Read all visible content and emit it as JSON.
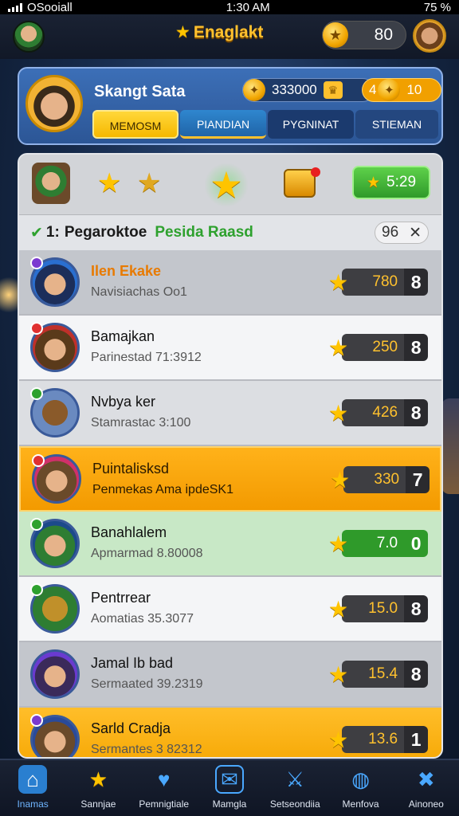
{
  "status": {
    "carrier": "OSooiall",
    "time": "1:30 AM",
    "battery": "75 %"
  },
  "topbar": {
    "title": "Enaglakt",
    "coins": "80",
    "coin_symbol": "★",
    "star": "★"
  },
  "profile": {
    "name": "Skangt Sata",
    "score": "333000",
    "level_prefix": "4",
    "level": "10",
    "tabs": [
      "MEMOSM",
      "PIANDIAN",
      "PYGNINAT",
      "STIEMAN"
    ]
  },
  "rewards": {
    "timer": "5:29",
    "star": "★"
  },
  "leaderboard": {
    "prefix": "1:",
    "title": "Pegaroktoe",
    "subtitle": "Pesida Raasd",
    "count": "96",
    "close": "✕",
    "rows": [
      {
        "name": "Ilen Ekake",
        "sub": "Navisiachas Oo1",
        "score": "780",
        "rank": "8"
      },
      {
        "name": "Bamajkan",
        "sub": "Parinestad 71:3912",
        "score": "250",
        "rank": "8"
      },
      {
        "name": "Nvbya ker",
        "sub": "Stamrastac 3:100",
        "score": "426",
        "rank": "8"
      },
      {
        "name": "Puintalisksd",
        "sub": "Penmekas Ama ipdeSK1",
        "score": "330",
        "rank": "7"
      },
      {
        "name": "Banahlalem",
        "sub": "Apmarmad 8.80008",
        "score": "7.0",
        "rank": "0"
      },
      {
        "name": "Pentrrear",
        "sub": "Aomatias 35.3077",
        "score": "15.0",
        "rank": "8"
      },
      {
        "name": "Jamal Ib bad",
        "sub": "Sermaated 39.2319",
        "score": "15.4",
        "rank": "8"
      },
      {
        "name": "Sarld Cradja",
        "sub": "Sermantes 3 82312",
        "score": "13.6",
        "rank": "1"
      }
    ]
  },
  "nav": [
    {
      "label": "Inamas",
      "icon": "home-icon",
      "glyph": "⌂"
    },
    {
      "label": "Sannjae",
      "icon": "star-icon",
      "glyph": "★"
    },
    {
      "label": "Pemnigtiale",
      "icon": "heart-icon",
      "glyph": "♥"
    },
    {
      "label": "Mamgla",
      "icon": "mail-icon",
      "glyph": "✉"
    },
    {
      "label": "Setseondiia",
      "icon": "swords-icon",
      "glyph": "⚔"
    },
    {
      "label": "Menfova",
      "icon": "globe-icon",
      "glyph": "◍"
    },
    {
      "label": "Ainoneo",
      "icon": "tools-icon",
      "glyph": "✖"
    }
  ],
  "colors": {
    "accent": "#ffc12e",
    "panel": "#c9ccd2",
    "highlight_orange": "#f5a500",
    "highlight_green": "#c8e8c6"
  }
}
